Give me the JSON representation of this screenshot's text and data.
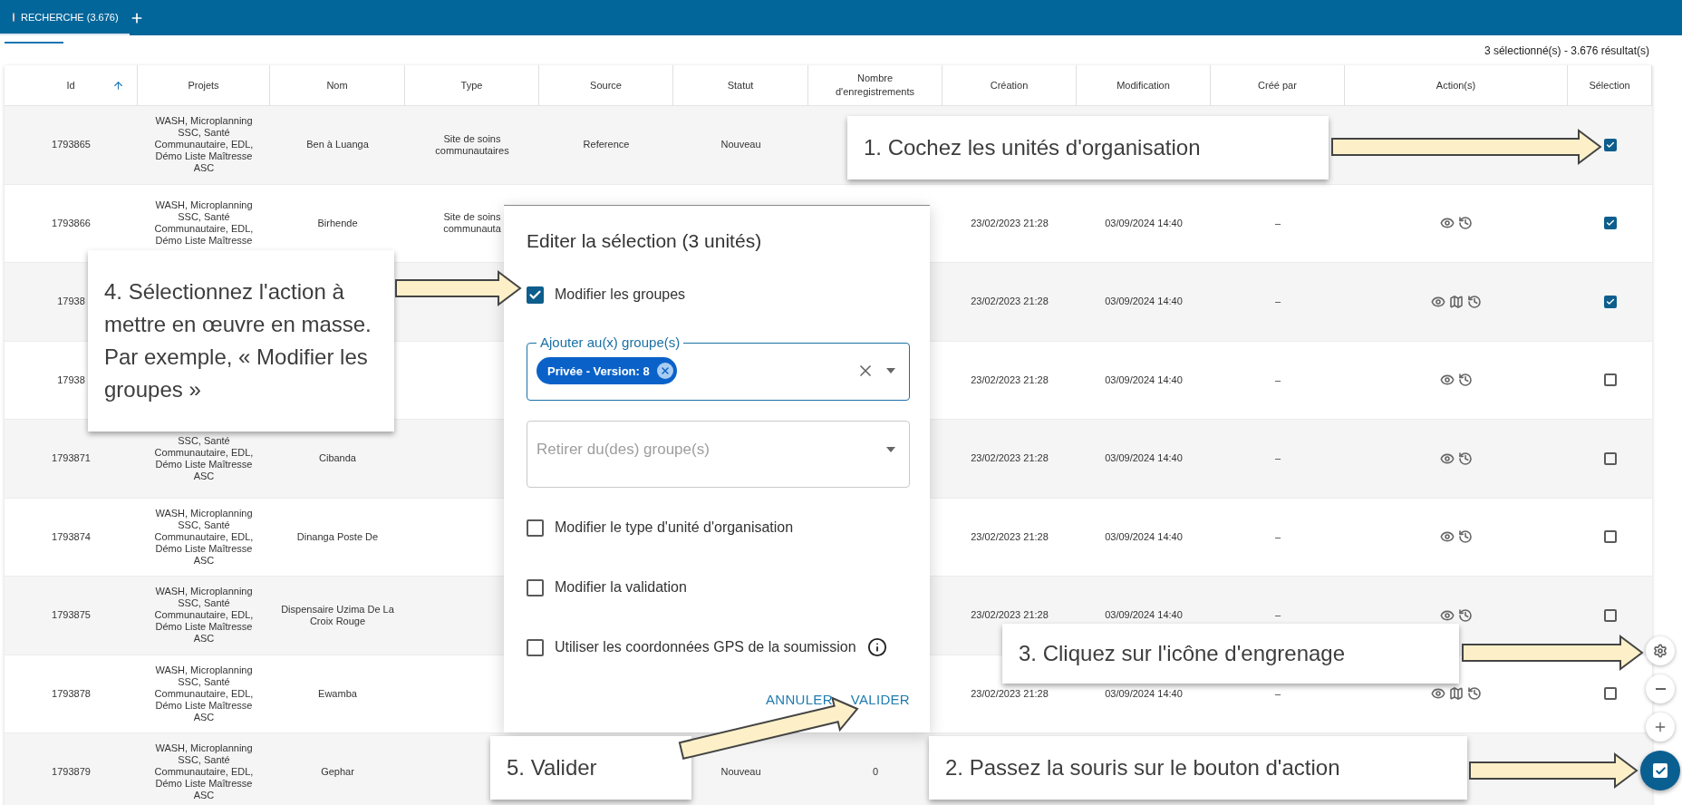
{
  "tab_bar": {
    "tabs": [
      {
        "label": "RECHERCHE (3.676)",
        "selected": true
      }
    ]
  },
  "summary": "3 sélectionné(s)  -  3.676 résultat(s)",
  "table": {
    "columns": [
      {
        "label": "Id",
        "sorted": true
      },
      {
        "label": "Projets",
        "sorted": false
      },
      {
        "label": "Nom",
        "sorted": false
      },
      {
        "label": "Type",
        "sorted": false
      },
      {
        "label": "Source",
        "sorted": false
      },
      {
        "label": "Statut",
        "sorted": false
      },
      {
        "label": "Nombre d'enregistrements",
        "sorted": false
      },
      {
        "label": "Création",
        "sorted": false
      },
      {
        "label": "Modification",
        "sorted": false
      },
      {
        "label": "Créé par",
        "sorted": false
      },
      {
        "label": "Action(s)",
        "sorted": false
      },
      {
        "label": "Sélection",
        "sorted": false
      }
    ],
    "rows": [
      {
        "cells": [
          "1793865",
          "WASH, Microplanning SSC, Santé Communautaire, EDL, Démo Liste Maîtresse ASC",
          "Ben à Luanga",
          "Site de soins communautaires",
          "Reference",
          "Nouveau",
          null,
          null,
          null,
          null
        ],
        "selected": true
      },
      {
        "cells": [
          "1793866",
          "WASH, Microplanning SSC, Santé Communautaire, EDL, Démo Liste Maîtresse",
          "Birhende",
          "Site de soins communauta",
          null,
          null,
          null,
          "23/02/2023 21:28",
          "03/09/2024 14:40",
          "–"
        ],
        "actions": [
          {
            "kind": "view"
          },
          {
            "kind": "history"
          }
        ],
        "selected": true
      },
      {
        "cells": [
          "17938",
          null,
          null,
          null,
          null,
          null,
          null,
          "23/02/2023 21:28",
          "03/09/2024 14:40",
          "–"
        ],
        "actions": [
          {
            "kind": "view"
          },
          {
            "kind": "map"
          },
          {
            "kind": "history"
          }
        ],
        "selected": true
      },
      {
        "cells": [
          "17938",
          null,
          null,
          null,
          null,
          null,
          null,
          "23/02/2023 21:28",
          "03/09/2024 14:40",
          "–"
        ],
        "actions": [
          {
            "kind": "view"
          },
          {
            "kind": "history"
          }
        ],
        "selected": false
      },
      {
        "cells": [
          "1793871",
          "SSC, Santé Communautaire, EDL, Démo Liste Maîtresse ASC",
          "Cibanda",
          null,
          null,
          null,
          null,
          "23/02/2023 21:28",
          "03/09/2024 14:40",
          "–"
        ],
        "actions": [
          {
            "kind": "view"
          },
          {
            "kind": "history"
          }
        ],
        "selected": false
      },
      {
        "cells": [
          "1793874",
          "WASH, Microplanning SSC, Santé Communautaire, EDL, Démo Liste Maîtresse ASC",
          "Dinanga Poste De",
          null,
          null,
          null,
          null,
          "23/02/2023 21:28",
          "03/09/2024 14:40",
          "–"
        ],
        "actions": [
          {
            "kind": "view"
          },
          {
            "kind": "history"
          }
        ],
        "selected": false
      },
      {
        "cells": [
          "1793875",
          "WASH, Microplanning SSC, Santé Communautaire, EDL, Démo Liste Maîtresse ASC",
          "Dispensaire Uzima De La Croix Rouge",
          null,
          null,
          null,
          null,
          "23/02/2023 21:28",
          "03/09/2024 14:40",
          "–"
        ],
        "actions": [
          {
            "kind": "view"
          },
          {
            "kind": "history"
          }
        ],
        "selected": false
      },
      {
        "cells": [
          "1793878",
          "WASH, Microplanning SSC, Santé Communautaire, EDL, Démo Liste Maîtresse ASC",
          "Ewamba",
          null,
          null,
          null,
          null,
          "23/02/2023 21:28",
          "03/09/2024 14:40",
          "–"
        ],
        "actions": [
          {
            "kind": "view"
          },
          {
            "kind": "map"
          },
          {
            "kind": "history"
          }
        ],
        "selected": false
      },
      {
        "cells": [
          "1793879",
          "WASH, Microplanning SSC, Santé Communautaire, EDL, Démo Liste Maîtresse ASC",
          "Gephar",
          null,
          null,
          "Nouveau",
          "0",
          null,
          null,
          null
        ]
      }
    ]
  },
  "dialog": {
    "title": "Editer la sélection (3 unités)",
    "options": [
      {
        "kind": "checkbox",
        "label": "Modifier les groupes",
        "checked": true
      },
      {
        "kind": "select",
        "label": "Ajouter au(x) groupe(s)",
        "chips": [
          "Privée - Version: 8"
        ],
        "focused": true
      },
      {
        "kind": "select",
        "placeholder": "Retirer du(des) groupe(s)",
        "focused": false
      },
      {
        "kind": "checkbox",
        "label": "Modifier le type d'unité d'organisation",
        "checked": false
      },
      {
        "kind": "checkbox",
        "label": "Modifier la validation",
        "checked": false
      },
      {
        "kind": "checkbox",
        "label": "Utiliser les coordonnées GPS de la soumission",
        "checked": false,
        "info": true
      }
    ],
    "buttons": [
      "ANNULER",
      "VALIDER"
    ]
  },
  "callouts": [
    {
      "text": "1. Cochez les unités d'organisation"
    },
    {
      "text": "4. Sélectionnez l'action à mettre en œuvre en masse. Par exemple, « Modifier les groupes »"
    },
    {
      "text": "3. Cliquez sur l'icône d'engrenage"
    },
    {
      "text": "5. Valider"
    },
    {
      "text": "2. Passez la souris sur le bouton d'action"
    }
  ]
}
